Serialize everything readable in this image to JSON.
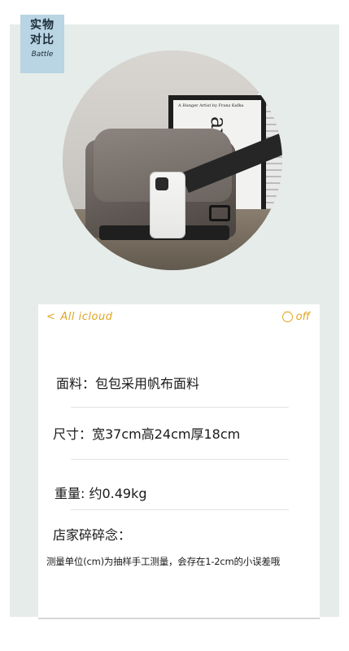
{
  "tag": {
    "line1": "实物",
    "line2": "对比",
    "sub": "Battle"
  },
  "photo": {
    "poster_title": "A Hunger Artist by Franz Kafka",
    "poster_script": "avec moi"
  },
  "notes": {
    "nav_left": "All icloud",
    "nav_right": "off",
    "material": "面料：包包采用帆布面料",
    "size": "尺寸：宽37cm高24cm厚18cm",
    "weight": "重量:  约0.49kg",
    "shop_title": "店家碎碎念：",
    "disclaimer": "测量单位(cm)为抽样手工测量，会存在1-2cm的小误差哦"
  },
  "colors": {
    "accent": "#e0a51f",
    "tag_bg": "#b9d4e3",
    "panel_bg": "#e6ece9"
  }
}
